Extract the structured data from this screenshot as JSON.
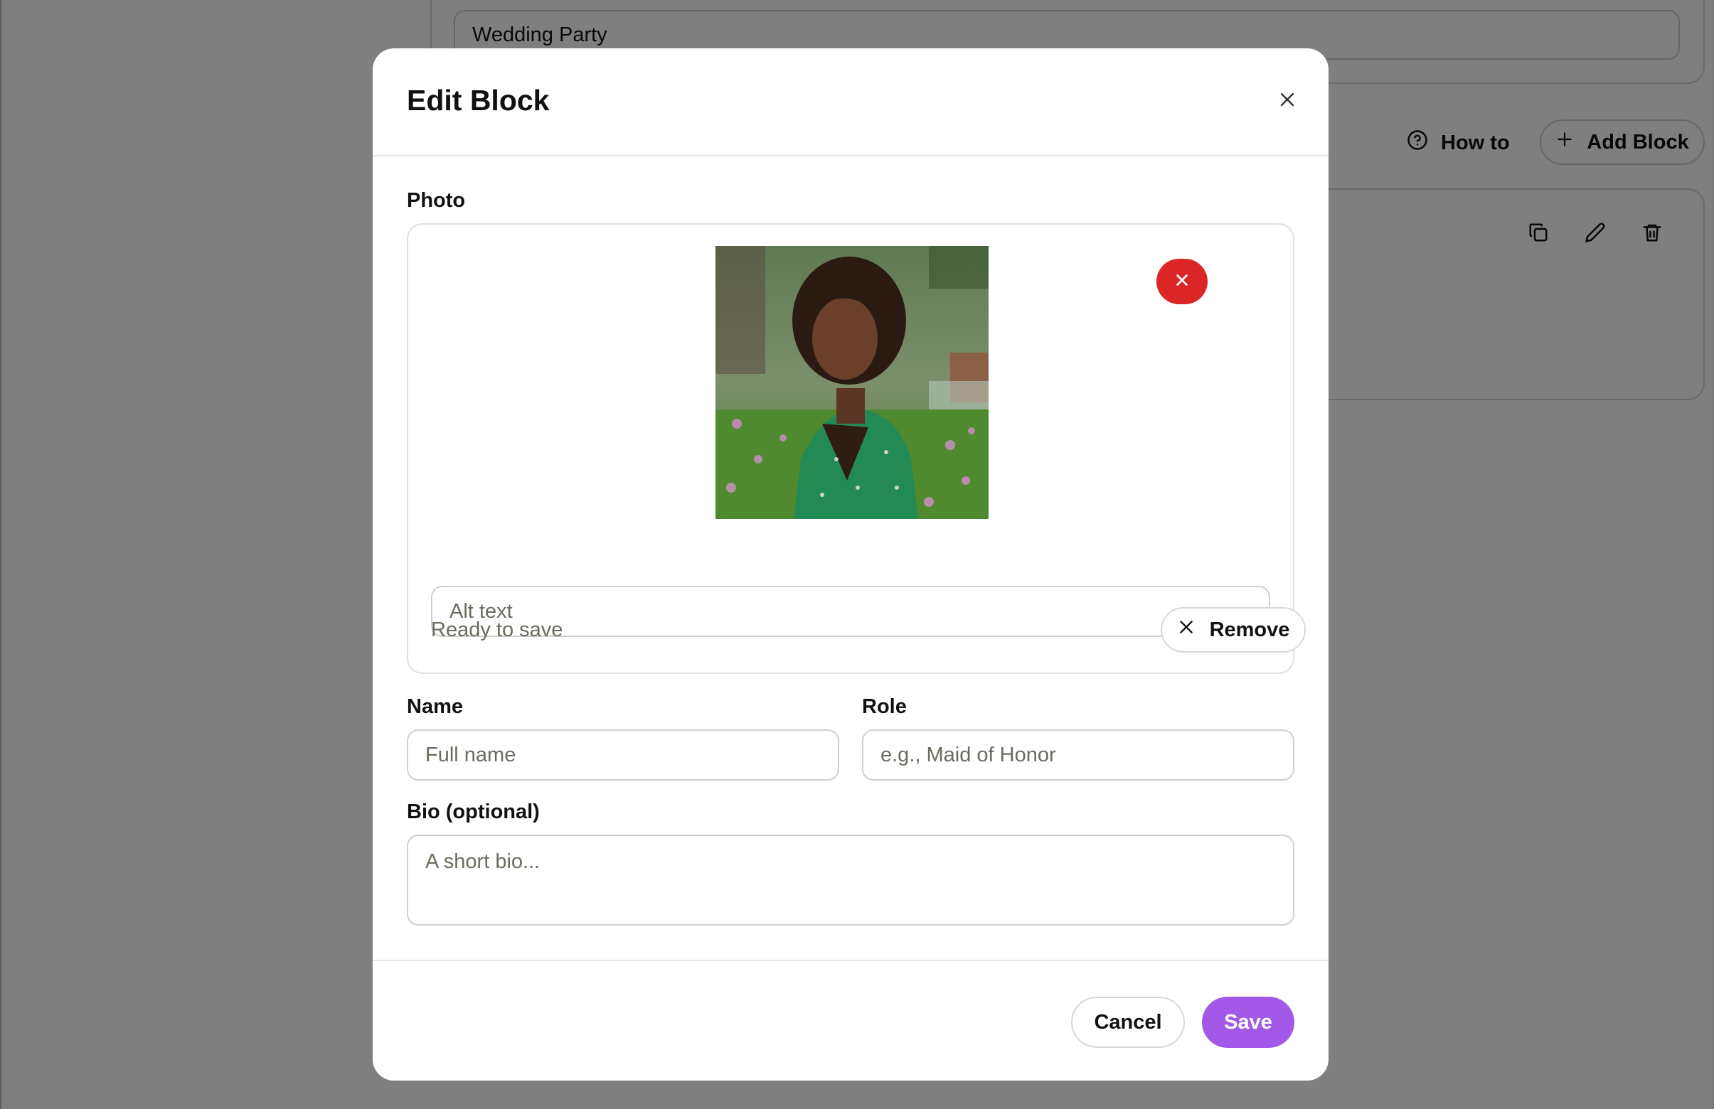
{
  "background": {
    "page_title_value": "Wedding Party",
    "how_to_label": "How to",
    "add_block_label": "Add Block"
  },
  "modal": {
    "title": "Edit Block",
    "photo": {
      "label": "Photo",
      "alt_placeholder": "Alt text",
      "status": "Ready to save",
      "remove_label": "Remove"
    },
    "name": {
      "label": "Name",
      "placeholder": "Full name"
    },
    "role": {
      "label": "Role",
      "placeholder": "e.g., Maid of Honor"
    },
    "bio": {
      "label": "Bio (optional)",
      "placeholder": "A short bio..."
    },
    "footer": {
      "cancel_label": "Cancel",
      "save_label": "Save"
    }
  },
  "colors": {
    "overlay": "#808080",
    "accent": "#a259e8",
    "danger": "#dc2626"
  },
  "icons": [
    "close-icon",
    "x-icon",
    "help-icon",
    "plus-icon",
    "copy-icon",
    "pencil-icon",
    "trash-icon"
  ]
}
